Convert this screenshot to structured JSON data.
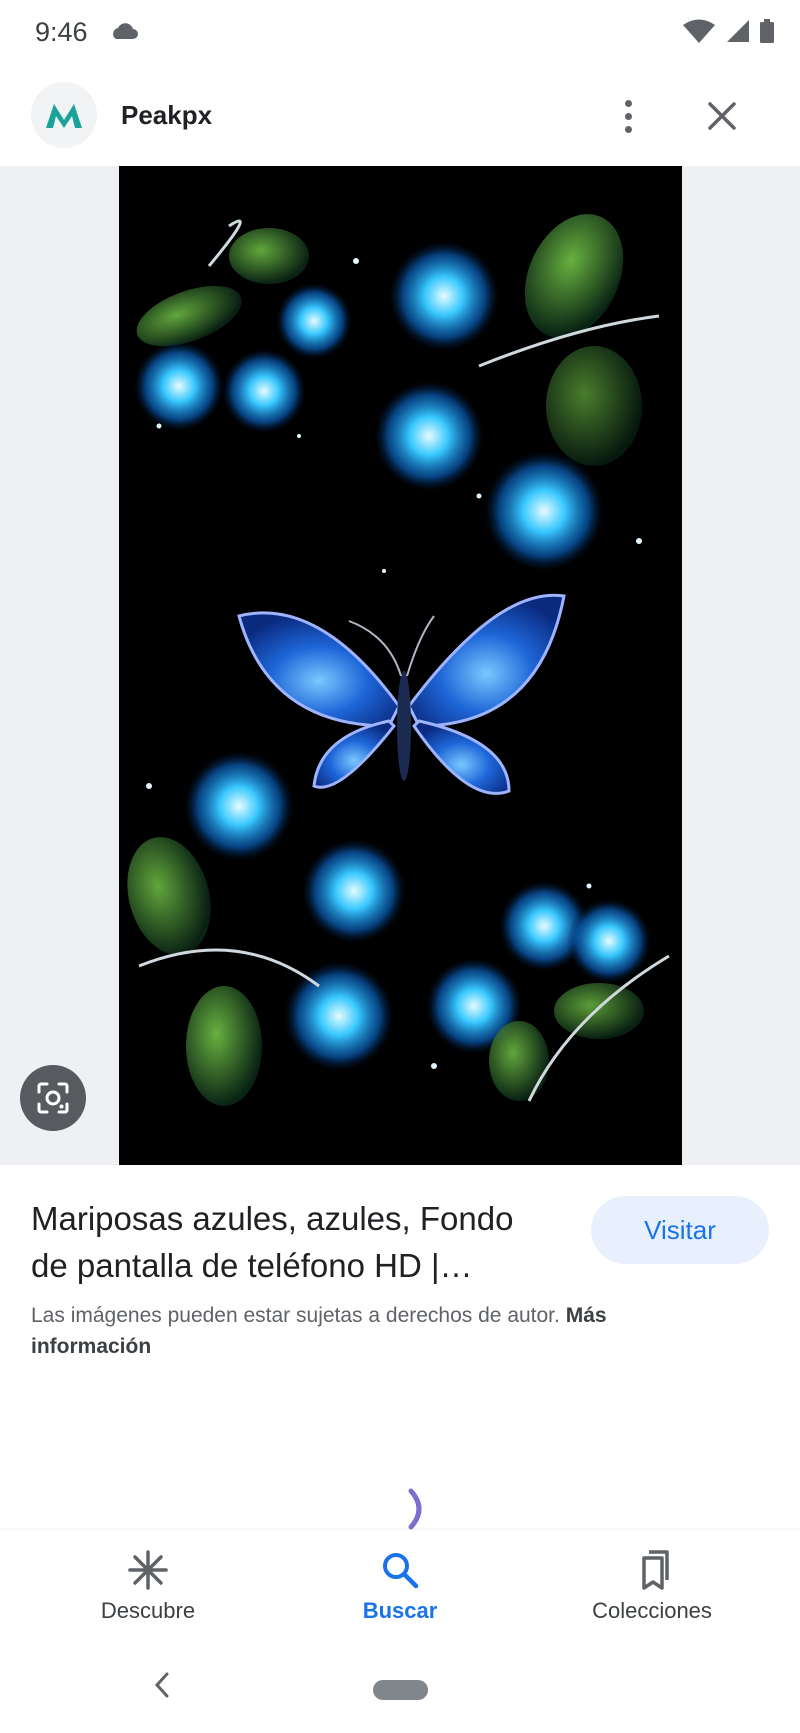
{
  "status": {
    "time": "9:46"
  },
  "header": {
    "site_name": "Peakpx"
  },
  "info": {
    "title": "Mariposas azules, azules, Fondo de pantalla de teléfono HD |…",
    "visit_label": "Visitar",
    "copyright_text": "Las imágenes pueden estar sujetas a derechos de autor.",
    "more_info_label": "Más información"
  },
  "bottom_nav": {
    "items": [
      {
        "label": "Descubre",
        "icon": "asterisk-icon"
      },
      {
        "label": "Buscar",
        "icon": "search-icon",
        "active": true
      },
      {
        "label": "Colecciones",
        "icon": "bookmarks-icon"
      }
    ]
  },
  "colors": {
    "accent": "#1a73e8",
    "visit_bg": "#e8f0fe",
    "logo": "#1aa39a"
  }
}
